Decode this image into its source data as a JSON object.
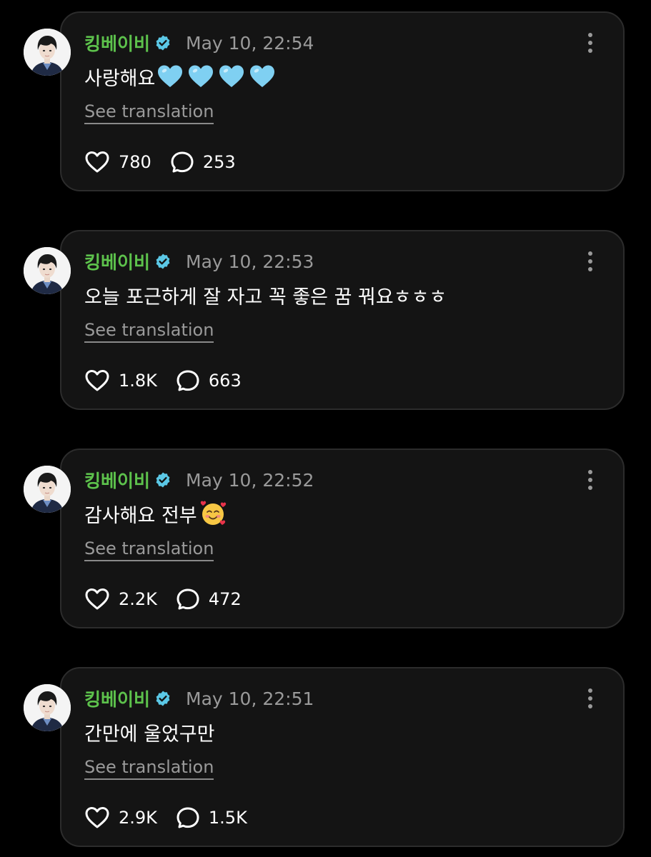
{
  "colors": {
    "background": "#000000",
    "card": "#141414",
    "username": "#5dc24c",
    "verified_badge": "#5bc8e6",
    "muted": "#9a9a9a"
  },
  "posts": [
    {
      "username": "킹베이비",
      "timestamp": "May 10, 22:54",
      "text": "사랑해요",
      "emoji": [
        "light-blue-heart-emoji",
        "light-blue-heart-emoji",
        "light-blue-heart-emoji",
        "light-blue-heart-emoji"
      ],
      "translate_label": "See translation",
      "likes": "780",
      "comments": "253"
    },
    {
      "username": "킹베이비",
      "timestamp": "May 10, 22:53",
      "text": "오늘 포근하게 잘 자고 꼭 좋은 꿈 꿔요ㅎㅎㅎ",
      "emoji": [],
      "translate_label": "See translation",
      "likes": "1.8K",
      "comments": "663"
    },
    {
      "username": "킹베이비",
      "timestamp": "May 10, 22:52",
      "text": "감사해요 전부",
      "emoji": [
        "smiling-face-with-hearts-emoji"
      ],
      "translate_label": "See translation",
      "likes": "2.2K",
      "comments": "472"
    },
    {
      "username": "킹베이비",
      "timestamp": "May 10, 22:51",
      "text": "간만에 울었구만",
      "emoji": [],
      "translate_label": "See translation",
      "likes": "2.9K",
      "comments": "1.5K"
    }
  ]
}
